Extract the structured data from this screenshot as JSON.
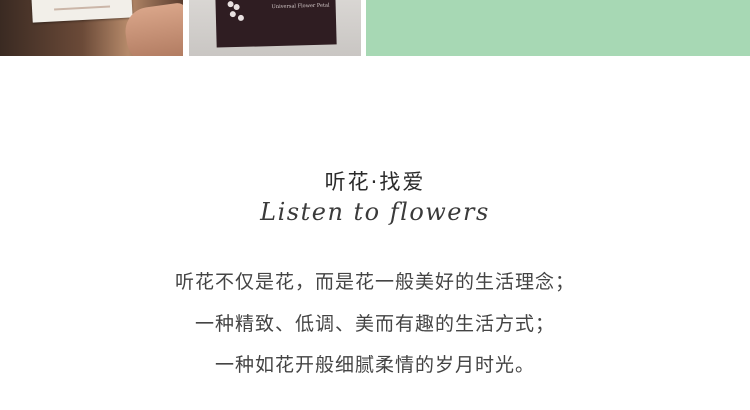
{
  "photo_strip": {
    "middle_packet_text": "Universal Flower Petal"
  },
  "title": "听花·找爱",
  "subtitle": "Listen to flowers",
  "paragraph": {
    "line1": "听花不仅是花，而是花一般美好的生活理念；",
    "line2": "一种精致、低调、美而有趣的生活方式；",
    "line3": "一种如花开般细腻柔情的岁月时光。"
  },
  "colors": {
    "mint_panel": "#a7d8b4",
    "text": "#444444"
  }
}
